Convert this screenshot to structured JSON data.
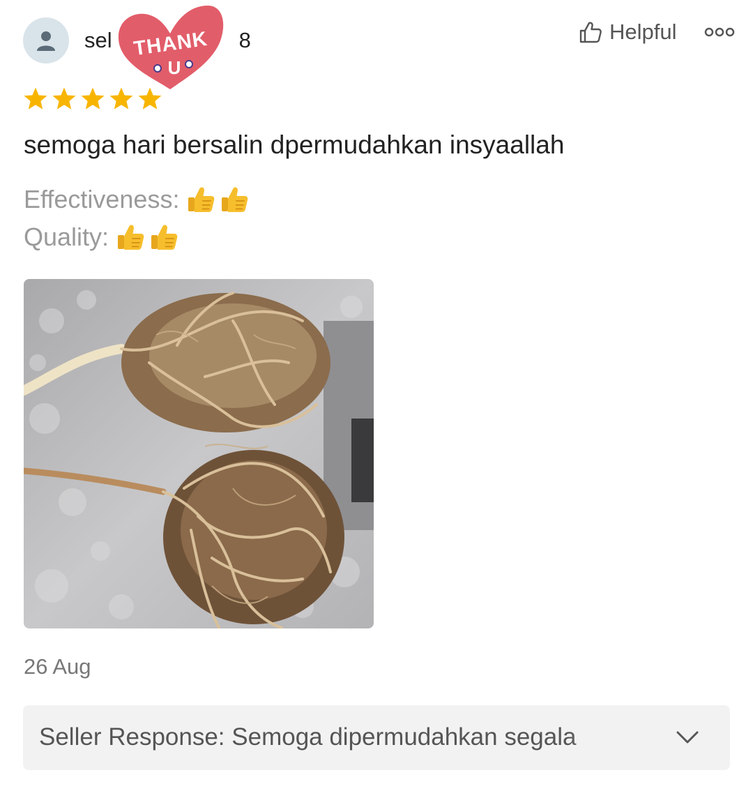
{
  "review": {
    "username_start": "sel",
    "username_end": "8",
    "sticker_text": "THANK",
    "sticker_face": "U",
    "helpful_label": "Helpful",
    "rating": 5,
    "text": "semoga hari bersalin dpermudahkan insyaallah",
    "attributes": [
      {
        "label": "Effectiveness:",
        "thumbs": 2
      },
      {
        "label": "Quality:",
        "thumbs": 2
      }
    ],
    "date": "26 Aug",
    "seller_response": "Seller Response: Semoga dipermudahkan segala"
  },
  "colors": {
    "star": "#f8b500",
    "sticker": "#e25d6a",
    "thumb": "#f6be2c",
    "seller_bg": "#f2f2f2"
  },
  "icons": {
    "avatar": "person-icon",
    "helpful": "thumbs-up-outline-icon",
    "more": "more-dots-icon",
    "chevron": "chevron-down-icon"
  }
}
